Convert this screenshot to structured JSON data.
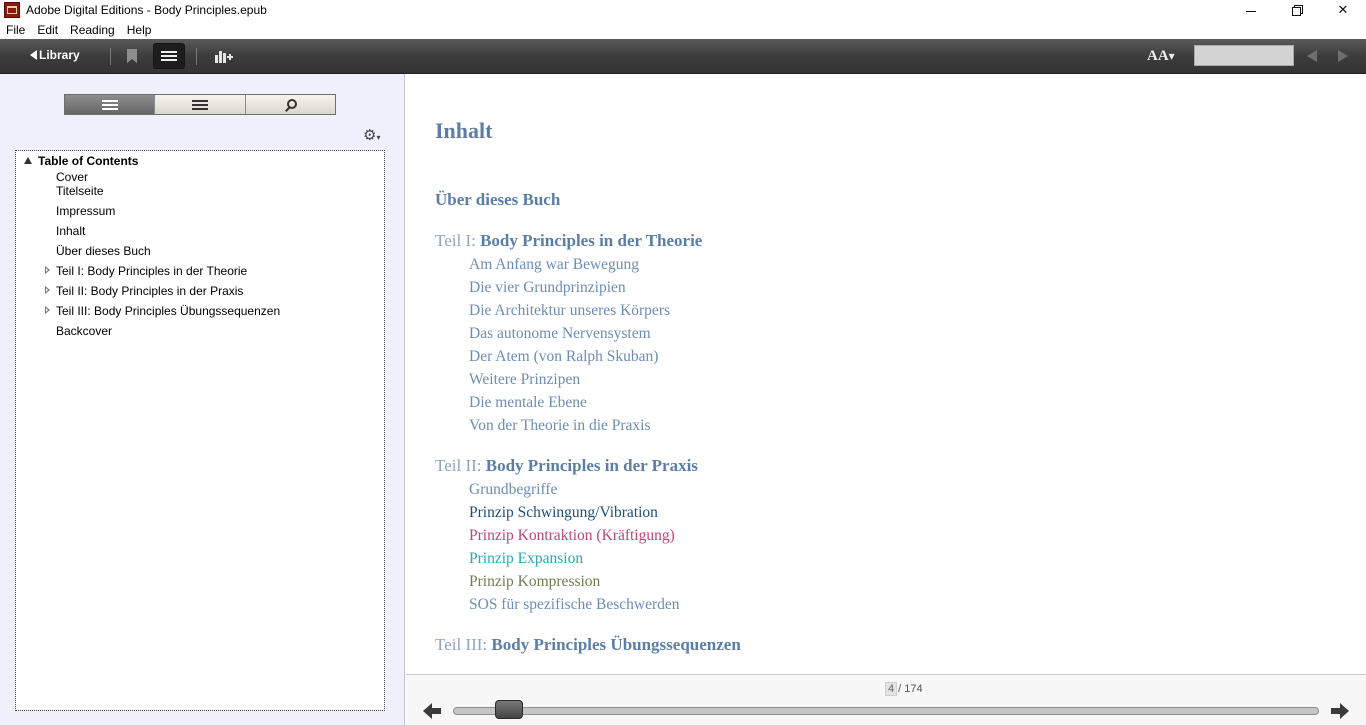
{
  "window": {
    "title": "Adobe Digital Editions - Body Principles.epub",
    "controls": {
      "minimize": "",
      "restore": "",
      "close": "✕"
    }
  },
  "menu": [
    {
      "label": "File"
    },
    {
      "label": "Edit"
    },
    {
      "label": "Reading"
    },
    {
      "label": "Help"
    }
  ],
  "toolbar": {
    "library_label": "Library",
    "font_size_label": "AA",
    "font_size_caret": "▾",
    "search_value": ""
  },
  "sidebar": {
    "gear_caret": "▾",
    "toc_root": "Table of Contents",
    "items": [
      {
        "label": "Cover",
        "expandable": false
      },
      {
        "label": "Titelseite",
        "expandable": false
      },
      {
        "label": "Impressum",
        "expandable": false
      },
      {
        "label": "Inhalt",
        "expandable": false
      },
      {
        "label": "Über dieses Buch",
        "expandable": false
      },
      {
        "label": "Teil I: Body Principles in der Theorie",
        "expandable": true
      },
      {
        "label": "Teil II: Body Principles in der Praxis",
        "expandable": true
      },
      {
        "label": "Teil III: Body Principles Übungssequenzen",
        "expandable": true
      },
      {
        "label": "Backcover",
        "expandable": false
      }
    ]
  },
  "content": {
    "title": "Inhalt",
    "intro": "Über dieses Buch",
    "parts": [
      {
        "prefix": "Teil I: ",
        "title": "Body Principles in der Theorie",
        "chapters": [
          {
            "label": "Am Anfang war Bewegung",
            "color": "#6d8db3"
          },
          {
            "label": "Die vier Grundprinzipien",
            "color": "#6d8db3"
          },
          {
            "label": "Die Architektur unseres Körpers",
            "color": "#6d8db3"
          },
          {
            "label": "Das autonome Nervensystem",
            "color": "#6d8db3"
          },
          {
            "label": "Der Atem (von Ralph Skuban)",
            "color": "#6d8db3"
          },
          {
            "label": "Weitere Prinzipen",
            "color": "#6d8db3"
          },
          {
            "label": "Die mentale Ebene",
            "color": "#6d8db3"
          },
          {
            "label": "Von der Theorie in die Praxis",
            "color": "#6d8db3"
          }
        ]
      },
      {
        "prefix": "Teil II: ",
        "title": "Body Principles in der Praxis",
        "chapters": [
          {
            "label": "Grundbegriffe",
            "color": "#6d8db3"
          },
          {
            "label": "Prinzip Schwingung/Vibration",
            "color": "#1d4f7c"
          },
          {
            "label": "Prinzip Kontraktion (Kräftigung)",
            "color": "#c2456d"
          },
          {
            "label": "Prinzip Expansion",
            "color": "#2aa8b3"
          },
          {
            "label": "Prinzip Kompression",
            "color": "#6b7f52"
          },
          {
            "label": "SOS für spezifische Beschwerden",
            "color": "#6d8db3"
          }
        ]
      },
      {
        "prefix": "Teil III: ",
        "title": "Body Principles Übungssequenzen",
        "chapters": []
      }
    ]
  },
  "pager": {
    "current_page": "4",
    "total_label": "/ 174",
    "progress_fraction": 0.035
  },
  "colors": {
    "toolbar": "#3c3c3c",
    "sidebar_bg": "#eef1fb",
    "heading_blue": "#5b7ea6",
    "link_blue": "#6d8db3"
  }
}
